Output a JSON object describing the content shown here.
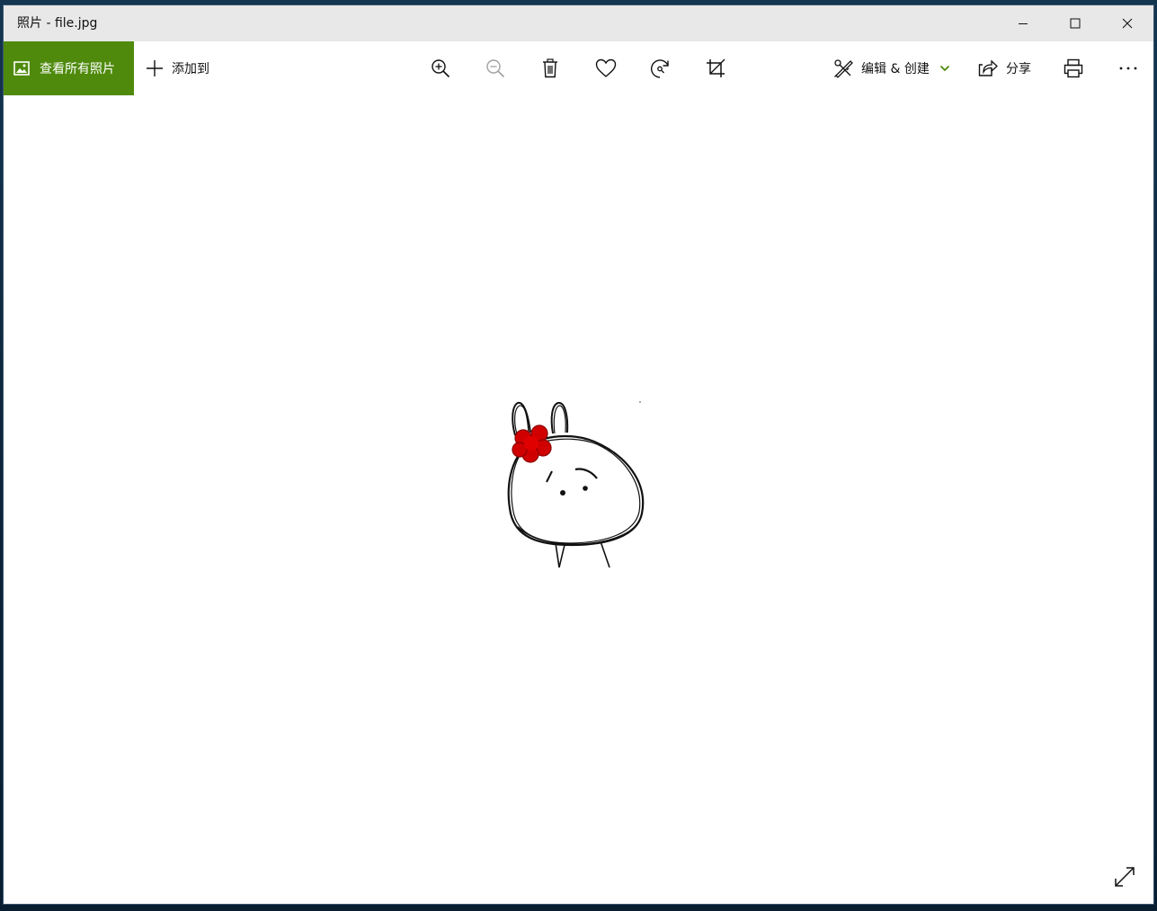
{
  "window": {
    "title": "照片 - file.jpg"
  },
  "titlebar_controls": {
    "minimize_icon": "minimize-icon",
    "maximize_icon": "maximize-icon",
    "close_icon": "close-icon"
  },
  "toolbar": {
    "view_all_label": "查看所有照片",
    "add_to_label": "添加到",
    "edit_create_label": "编辑 & 创建",
    "share_label": "分享",
    "tools": [
      "zoom-in-icon",
      "zoom-out-icon",
      "delete-icon",
      "favorite-icon",
      "rotate-icon",
      "crop-icon"
    ]
  },
  "colors": {
    "accent": "#4f8a0d",
    "titlebar_bg": "#e8e8e8",
    "disabled_icon": "#a0a0a0",
    "bow": "#d10000"
  }
}
